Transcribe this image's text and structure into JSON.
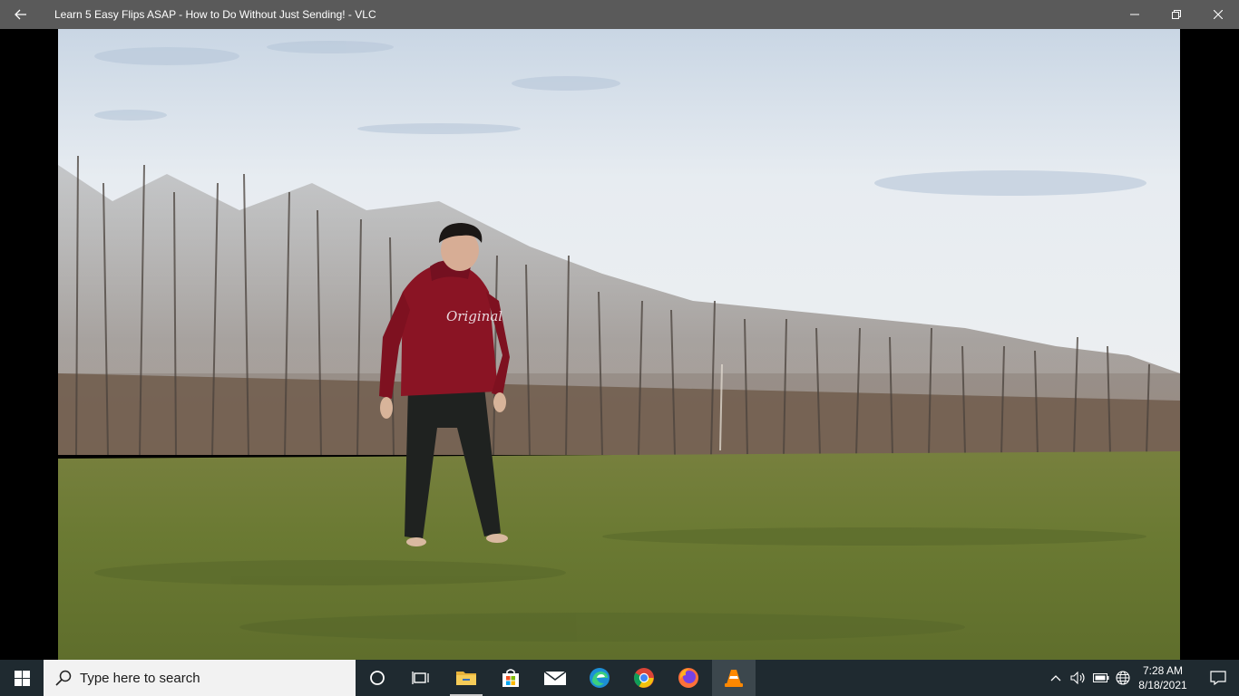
{
  "window": {
    "title": "Learn 5 Easy Flips ASAP - How to Do Without Just Sending! - VLC",
    "back_icon": "arrow-left-icon",
    "controls": [
      "minimize-icon",
      "restore-icon",
      "close-icon"
    ]
  },
  "video": {
    "scene": "video-frame",
    "hoodie_text": "Original"
  },
  "taskbar": {
    "search_placeholder": "Type here to search",
    "apps": [
      {
        "name": "cortana",
        "icon": "circle-icon"
      },
      {
        "name": "task-view",
        "icon": "task-view-icon"
      },
      {
        "name": "file-explorer",
        "icon": "folder-icon",
        "running": true
      },
      {
        "name": "microsoft-store",
        "icon": "store-icon"
      },
      {
        "name": "mail",
        "icon": "mail-icon"
      },
      {
        "name": "edge",
        "icon": "edge-icon"
      },
      {
        "name": "chrome",
        "icon": "chrome-icon"
      },
      {
        "name": "firefox",
        "icon": "firefox-icon"
      },
      {
        "name": "vlc",
        "icon": "vlc-cone-icon",
        "active": true
      }
    ],
    "clock": {
      "time": "7:28 AM",
      "date": "8/18/2021"
    }
  },
  "colors": {
    "titlebar": "#5a5a5a",
    "taskbar": "#1f2a30",
    "hoodie": "#8a1424",
    "grass": "#6e7a35",
    "sky": "#e9eef3"
  }
}
